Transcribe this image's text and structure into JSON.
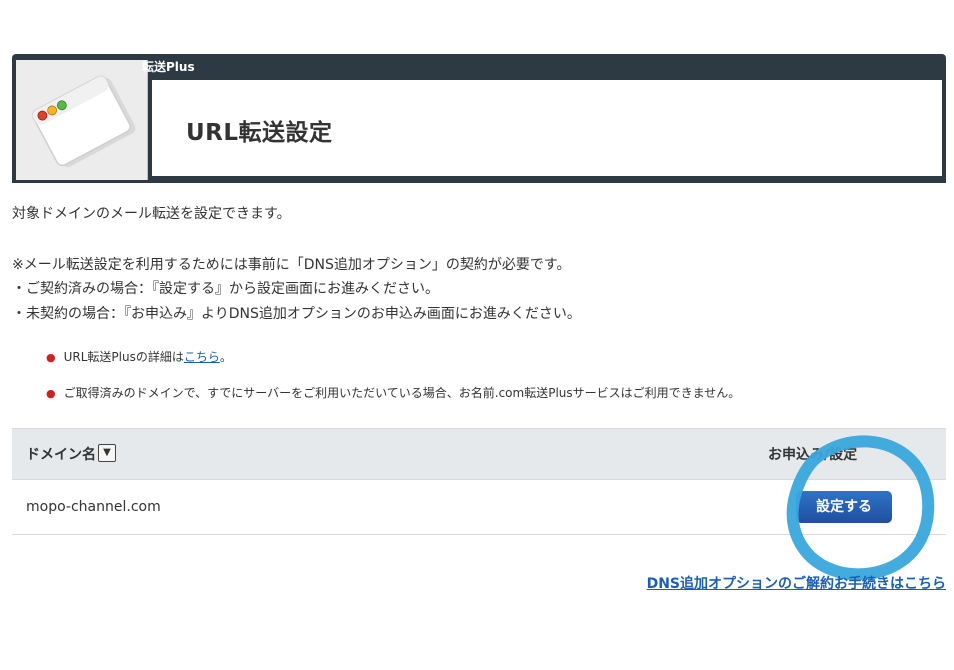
{
  "header": {
    "service_label": "転送Plus",
    "page_title": "URL転送設定"
  },
  "intro": {
    "line1": "対象ドメインのメール転送を設定できます。",
    "note": "※メール転送設定を利用するためには事前に「DNS追加オプション」の契約が必要です。",
    "contracted": "・ご契約済みの場合：『設定する』から設定画面にお進みください。",
    "not_contracted": "・未契約の場合：『お申込み』よりDNS追加オプションのお申込み画面にお進みください。"
  },
  "bullets": {
    "item1_text": "URL転送Plusの詳細は",
    "item1_link": "こちら",
    "item1_tail": "。",
    "item2_text": "ご取得済みのドメインで、すでにサーバーをご利用いただいている場合、お名前.com転送Plusサービスはご利用できません。"
  },
  "table": {
    "col_domain": "ドメイン名",
    "sort_icon": "▼",
    "col_action": "お申込み/設定",
    "rows": [
      {
        "domain": "mopo-channel.com",
        "action_label": "設定する"
      }
    ]
  },
  "footer": {
    "link_text": "DNS追加オプションのご解約お手続きはこちら"
  },
  "colors": {
    "header_bar": "#2d3a44",
    "button": "#2a62b8",
    "annotation_circle": "#3aa6dc",
    "link": "#1a5fb4"
  }
}
